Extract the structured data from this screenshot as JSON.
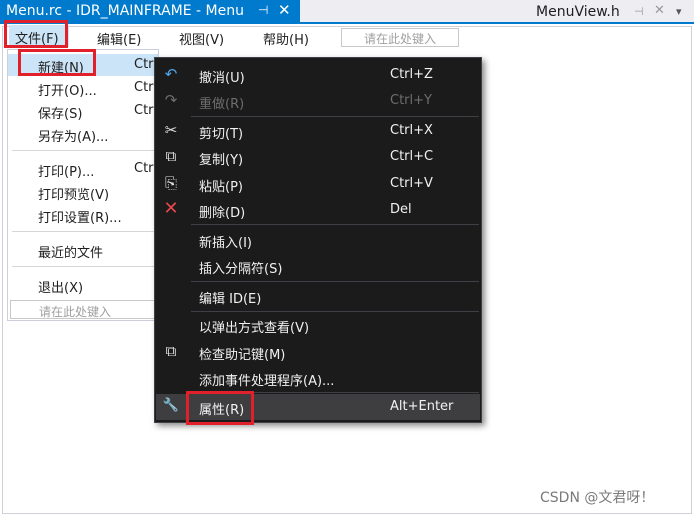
{
  "tabs": {
    "active": {
      "title": "Menu.rc - IDR_MAINFRAME - Menu",
      "pin": "⊣",
      "close": "✕"
    },
    "inactive": {
      "title": "MenuView.h",
      "pin": "⊣",
      "close": "✕",
      "arrow": "▾"
    }
  },
  "menubar": {
    "file": "文件(F)",
    "edit": "编辑(E)",
    "view": "视图(V)",
    "help": "帮助(H)",
    "type_here": "请在此处键入"
  },
  "file_menu": {
    "items": [
      {
        "label": "新建(N)",
        "shortcut": "Ctrl"
      },
      {
        "label": "打开(O)...",
        "shortcut": "Ctrl"
      },
      {
        "label": "保存(S)",
        "shortcut": "Ctr"
      },
      {
        "label": "另存为(A)...",
        "shortcut": ""
      },
      {
        "label": "打印(P)...",
        "shortcut": "Ctr"
      },
      {
        "label": "打印预览(V)",
        "shortcut": ""
      },
      {
        "label": "打印设置(R)...",
        "shortcut": ""
      },
      {
        "label": "最近的文件",
        "shortcut": ""
      },
      {
        "label": "退出(X)",
        "shortcut": ""
      }
    ],
    "type_here": "请在此处键入"
  },
  "context_menu": {
    "items": [
      {
        "icon": "undo-icon",
        "glyph": "↶",
        "label": "撤消(U)",
        "shortcut": "Ctrl+Z",
        "enabled": true
      },
      {
        "icon": "redo-icon",
        "glyph": "↷",
        "label": "重做(R)",
        "shortcut": "Ctrl+Y",
        "enabled": false
      },
      {
        "icon": "cut-icon",
        "glyph": "✂",
        "label": "剪切(T)",
        "shortcut": "Ctrl+X",
        "enabled": true
      },
      {
        "icon": "copy-icon",
        "glyph": "⧉",
        "label": "复制(Y)",
        "shortcut": "Ctrl+C",
        "enabled": true
      },
      {
        "icon": "paste-icon",
        "glyph": "⎘",
        "label": "粘贴(P)",
        "shortcut": "Ctrl+V",
        "enabled": true
      },
      {
        "icon": "delete-icon",
        "glyph": "✕",
        "label": "删除(D)",
        "shortcut": "Del",
        "enabled": true
      },
      {
        "icon": "",
        "glyph": "",
        "label": "新插入(I)",
        "shortcut": "",
        "enabled": true
      },
      {
        "icon": "",
        "glyph": "",
        "label": "插入分隔符(S)",
        "shortcut": "",
        "enabled": true
      },
      {
        "icon": "",
        "glyph": "",
        "label": "编辑 ID(E)",
        "shortcut": "",
        "enabled": true
      },
      {
        "icon": "",
        "glyph": "",
        "label": "以弹出方式查看(V)",
        "shortcut": "",
        "enabled": true
      },
      {
        "icon": "check-mnemonics-icon",
        "glyph": "⧉",
        "label": "检查助记键(M)",
        "shortcut": "",
        "enabled": true
      },
      {
        "icon": "",
        "glyph": "",
        "label": "添加事件处理程序(A)...",
        "shortcut": "",
        "enabled": true
      },
      {
        "icon": "wrench-icon",
        "glyph": "🔧",
        "label": "属性(R)",
        "shortcut": "Alt+Enter",
        "enabled": true
      }
    ]
  },
  "colors": {
    "accent": "#007acc",
    "annotation": "#e0202a",
    "menu_dark": "#1b1b1c",
    "delete_icon": "#e5484d"
  },
  "watermark": "CSDN @文君呀！"
}
